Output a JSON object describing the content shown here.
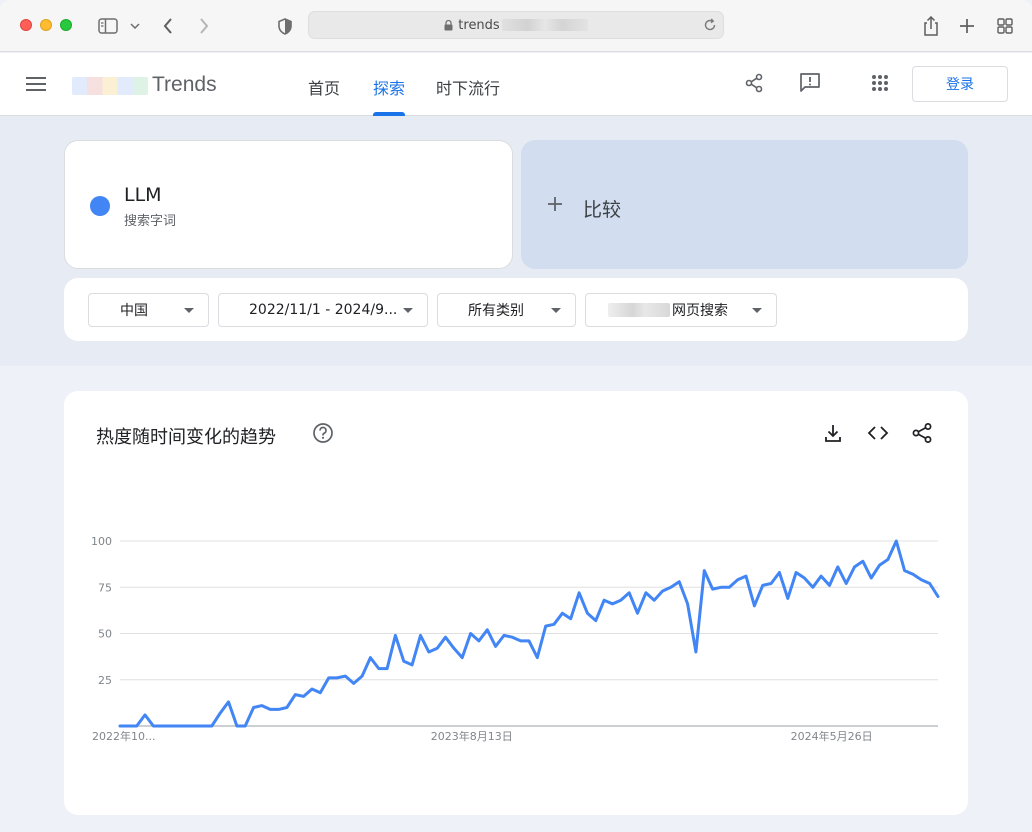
{
  "browser": {
    "url_prefix": "trends",
    "icons": [
      "sidebar-icon",
      "chevron-down-icon",
      "back-icon",
      "forward-icon",
      "privacy-shield-icon",
      "lock-icon",
      "reload-icon",
      "share-icon",
      "new-tab-icon",
      "tab-overview-icon"
    ]
  },
  "header": {
    "logo_text": "Trends",
    "tabs": [
      {
        "label": "首页",
        "active": false
      },
      {
        "label": "探索",
        "active": true
      },
      {
        "label": "时下流行",
        "active": false
      }
    ],
    "login_label": "登录",
    "icons": [
      "share-icon",
      "feedback-icon",
      "apps-grid-icon"
    ]
  },
  "explore": {
    "term": {
      "name": "LLM",
      "type": "搜索字词",
      "color": "#4285f4"
    },
    "compare_label": "比较",
    "compare_icon": "plus-icon"
  },
  "filters": [
    {
      "label": "中国"
    },
    {
      "label": "2022/11/1 - 2024/9..."
    },
    {
      "label": "所有类别"
    },
    {
      "label": "网页搜索"
    }
  ],
  "chart_card": {
    "title": "热度随时间变化的趋势",
    "icons": [
      "help-icon",
      "download-icon",
      "embed-code-icon",
      "share-icon"
    ]
  },
  "chart_data": {
    "type": "line",
    "title": "热度随时间变化的趋势",
    "ylim": [
      0,
      100
    ],
    "yticks": [
      25,
      50,
      75,
      100
    ],
    "xtick_labels": [
      "2022年10...",
      "2023年8月13日",
      "2024年5月26日"
    ],
    "grid": true,
    "series": [
      {
        "color": "#4285f4",
        "values": [
          0,
          0,
          0,
          6,
          0,
          0,
          0,
          0,
          0,
          0,
          0,
          0,
          7,
          13,
          0,
          0,
          10,
          11,
          9,
          9,
          10,
          17,
          16,
          20,
          18,
          26,
          26,
          27,
          23,
          27,
          37,
          31,
          31,
          49,
          35,
          33,
          49,
          40,
          42,
          48,
          42,
          37,
          50,
          46,
          52,
          43,
          49,
          48,
          46,
          46,
          37,
          54,
          55,
          61,
          58,
          72,
          61,
          57,
          68,
          66,
          68,
          72,
          61,
          72,
          68,
          73,
          75,
          78,
          66,
          40,
          84,
          74,
          75,
          75,
          79,
          81,
          65,
          76,
          77,
          83,
          69,
          83,
          80,
          75,
          81,
          76,
          86,
          77,
          86,
          89,
          80,
          87,
          90,
          100,
          84,
          82,
          79,
          77,
          70
        ]
      }
    ]
  }
}
